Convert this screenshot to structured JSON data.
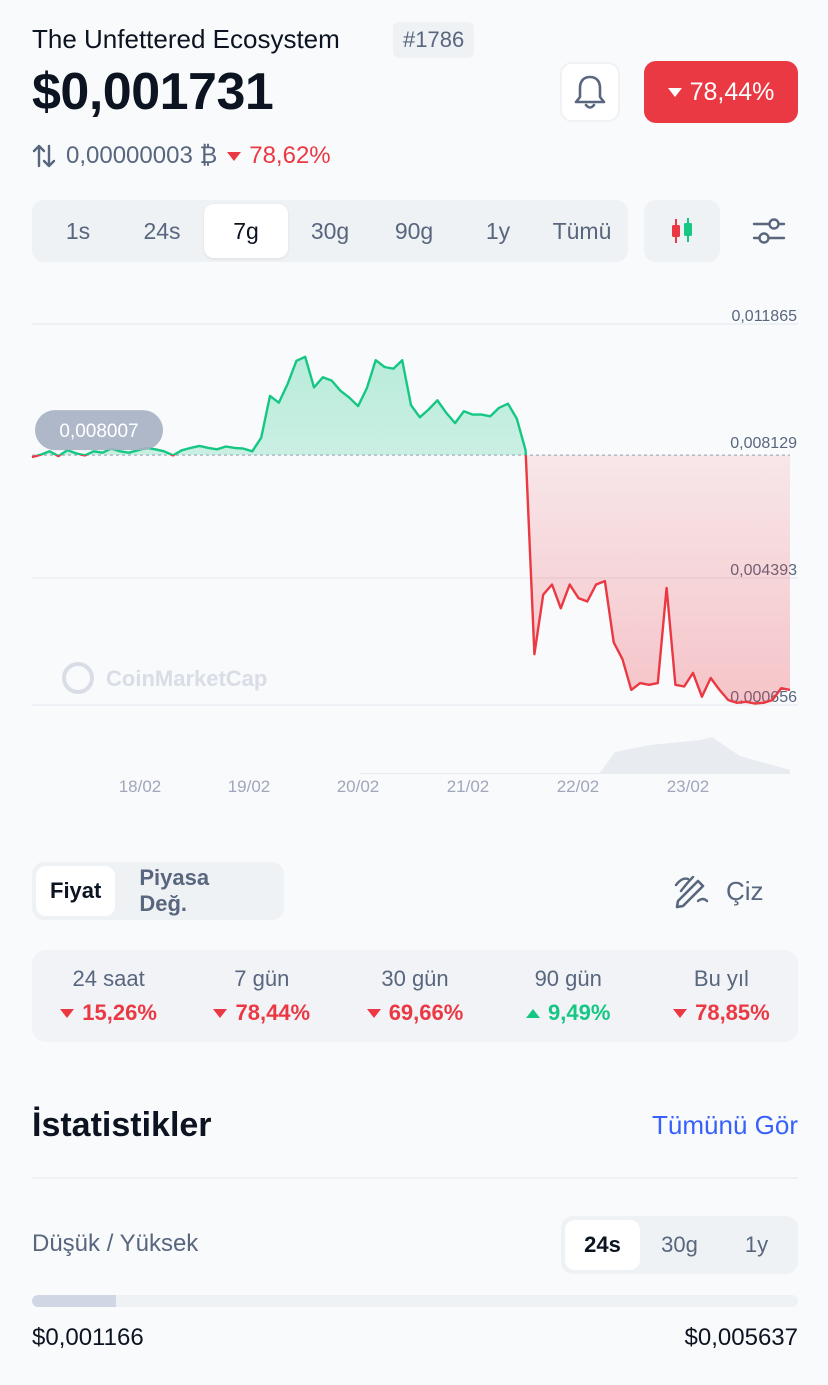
{
  "header": {
    "coin_name": "The Unfettered Ecosystem",
    "rank": "#1786",
    "price": "$0,001731",
    "change_7d": "78,44%",
    "btc_price": "0,00000003 ₿",
    "btc_change": "78,62%",
    "icons": {
      "alert": "bell-icon",
      "swap": "swap-vertical-icon"
    }
  },
  "range_tabs": [
    "1s",
    "24s",
    "7g",
    "30g",
    "90g",
    "1y",
    "Tümü"
  ],
  "range_active": "7g",
  "chart_tools": {
    "candle": "candlestick-icon",
    "settings": "sliders-icon"
  },
  "chart_data": {
    "type": "line",
    "x_labels": [
      "18/02",
      "19/02",
      "20/02",
      "21/02",
      "22/02",
      "23/02"
    ],
    "y_ticks": [
      "0,011865",
      "0,008129",
      "0,004393",
      "0,000656"
    ],
    "ylim": [
      0.000656,
      0.011865
    ],
    "baseline_value": 0.008007,
    "baseline_label": "0,008007",
    "watermark": "CoinMarketCap",
    "up_color": "#16c784",
    "down_color": "#ea3943",
    "series": [
      {
        "values": [
          0.00795,
          0.00802,
          0.00812,
          0.00798,
          0.00815,
          0.00806,
          0.008,
          0.00812,
          0.00808,
          0.0082,
          0.00812,
          0.00808,
          0.00815,
          0.00822,
          0.00818,
          0.00812,
          0.008,
          0.00815,
          0.00822,
          0.00828,
          0.00822,
          0.00818,
          0.00826,
          0.00822,
          0.0082,
          0.00812,
          0.00852,
          0.00975,
          0.00955,
          0.0101,
          0.01078,
          0.0109,
          0.01,
          0.0103,
          0.0102,
          0.0099,
          0.0097,
          0.00945,
          0.00998,
          0.0108,
          0.0106,
          0.01055,
          0.0108,
          0.00948,
          0.00912,
          0.00935,
          0.00962,
          0.00925,
          0.00895,
          0.0093,
          0.0092,
          0.0092,
          0.00915,
          0.0094,
          0.00952,
          0.00908,
          0.00815,
          0.00215,
          0.0039,
          0.0042,
          0.0035,
          0.0042,
          0.0038,
          0.0037,
          0.0042,
          0.0043,
          0.0025,
          0.002,
          0.0011,
          0.0013,
          0.00125,
          0.0013,
          0.0041,
          0.00125,
          0.0012,
          0.0016,
          0.0009,
          0.00145,
          0.0011,
          0.0008,
          0.00072,
          0.00075,
          0.0007,
          0.00072,
          0.0008,
          0.00115,
          0.0011
        ]
      }
    ]
  },
  "metric_tabs": [
    "Fiyat",
    "Piyasa Değ."
  ],
  "metric_active": "Fiyat",
  "draw_label": "Çiz",
  "performance": [
    {
      "label": "24 saat",
      "value": "15,26%",
      "dir": "down"
    },
    {
      "label": "7 gün",
      "value": "78,44%",
      "dir": "down"
    },
    {
      "label": "30 gün",
      "value": "69,66%",
      "dir": "down"
    },
    {
      "label": "90 gün",
      "value": "9,49%",
      "dir": "up"
    },
    {
      "label": "Bu yıl",
      "value": "78,85%",
      "dir": "down"
    }
  ],
  "stats": {
    "title": "İstatistikler",
    "see_all": "Tümünü Gör",
    "low_high_label": "Düşük / Yüksek",
    "lh_tabs": [
      "24s",
      "30g",
      "1y"
    ],
    "lh_active": "24s",
    "low": "$0,001166",
    "high": "$0,005637",
    "position_fraction": 0.11
  }
}
